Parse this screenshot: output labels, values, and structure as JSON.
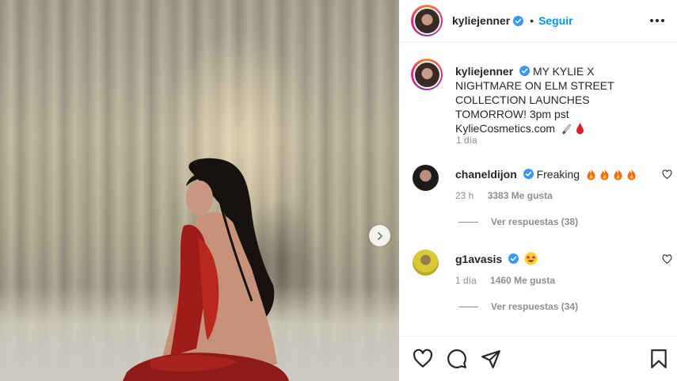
{
  "post": {
    "username": "kyliejenner",
    "verified": true,
    "separator": "•",
    "follow_label": "Seguir",
    "more_icon": "more-options-icon",
    "caption": {
      "username": "kyliejenner",
      "text": "MY KYLIE X NIGHTMARE ON ELM STREET COLLECTION LAUNCHES TOMORROW! 3pm pst KylieCosmetics.com",
      "emojis": [
        "knife-emoji",
        "blood-drop-emoji"
      ],
      "time": "1 día"
    }
  },
  "comments": [
    {
      "username": "chaneldijon",
      "verified": true,
      "text": "Freaking",
      "emojis": [
        "fire-emoji",
        "fire-emoji",
        "fire-emoji",
        "fire-emoji"
      ],
      "time": "23 h",
      "likes": "3383 Me gusta",
      "replies": "Ver respuestas (38)"
    },
    {
      "username": "g1avasis",
      "verified": true,
      "text": "",
      "emojis": [
        "star-struck-emoji"
      ],
      "time": "1 día",
      "likes": "1460 Me gusta",
      "replies": "Ver respuestas (34)"
    }
  ],
  "colors": {
    "link": "#0095f6",
    "verified": "#3897f0",
    "muted": "#8e8e8e",
    "text": "#262626"
  },
  "actions": [
    "like-icon",
    "comment-icon",
    "share-icon",
    "save-icon"
  ]
}
